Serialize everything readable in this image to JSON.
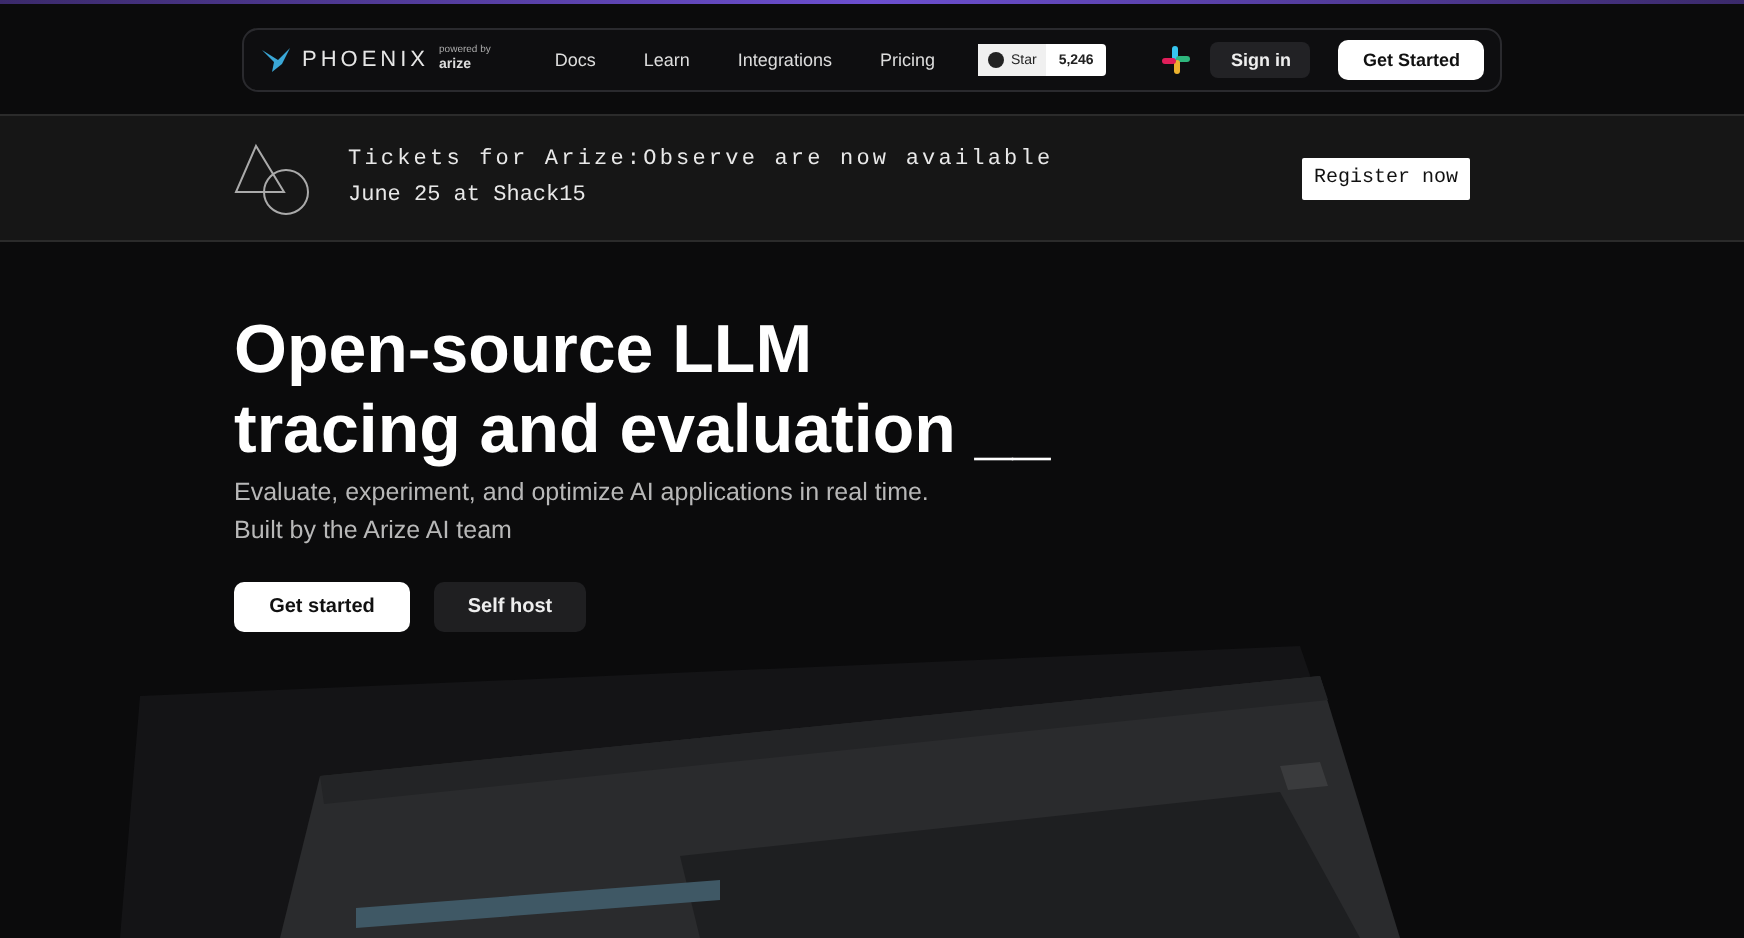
{
  "nav": {
    "brand": "PHOENIX",
    "powered_by": "powered by",
    "powered_brand": "arize",
    "links": [
      {
        "label": "Docs"
      },
      {
        "label": "Learn"
      },
      {
        "label": "Integrations"
      },
      {
        "label": "Pricing"
      }
    ],
    "github": {
      "label": "Star",
      "count": "5,246"
    },
    "sign_in": "Sign in",
    "get_started": "Get Started"
  },
  "banner": {
    "line1": "Tickets for Arize:Observe are now available",
    "line2": "June 25 at Shack15",
    "button": "Register now"
  },
  "hero": {
    "title_line1": "Open-source LLM",
    "title_line2": "tracing and evaluation",
    "cursor": "__",
    "subtitle_line1": "Evaluate, experiment, and optimize AI applications in real time.",
    "subtitle_line2": "Built by the Arize AI team",
    "buttons": [
      {
        "label": "Get started",
        "kind": "primary"
      },
      {
        "label": "Self host",
        "kind": "secondary"
      }
    ]
  }
}
